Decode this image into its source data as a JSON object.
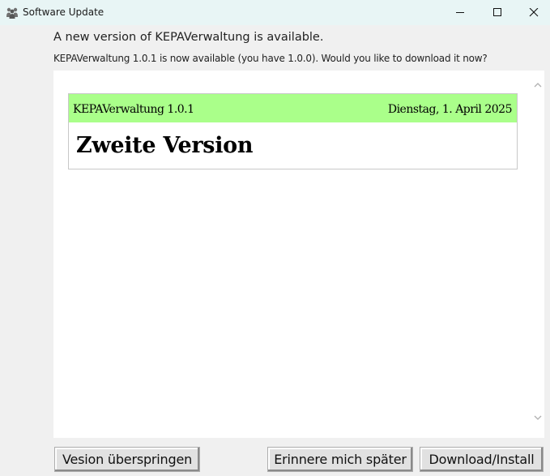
{
  "window": {
    "title": "Software Update",
    "icon": "users-app-icon",
    "controls": [
      "minimize-icon",
      "maximize-icon",
      "close-icon"
    ]
  },
  "header": {
    "headline": "A new version of KEPAVerwaltung is available.",
    "subline": "KEPAVerwaltung 1.0.1 is now available (you have 1.0.0). Would you like to download it now?"
  },
  "release_notes": {
    "name": "KEPAVerwaltung 1.0.1",
    "date": "Dienstag, 1. April 2025",
    "heading": "Zweite Version",
    "bar_color": "#aaff8a"
  },
  "buttons": {
    "skip": "Vesion überspringen",
    "later": "Erinnere mich später",
    "install": "Download/Install"
  }
}
